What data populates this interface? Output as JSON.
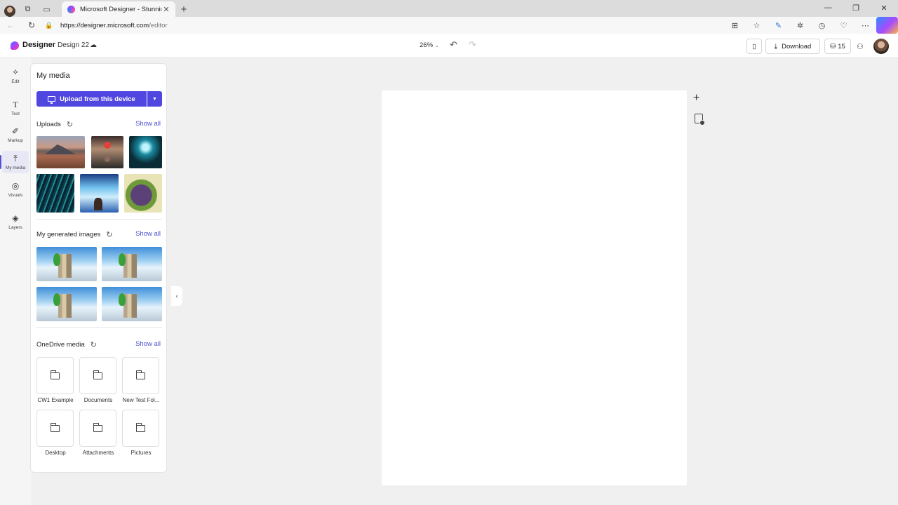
{
  "browser": {
    "tab_title": "Microsoft Designer - Stunning de",
    "url_host": "https://designer.microsoft.com",
    "url_path": "/editor"
  },
  "header": {
    "brand": "Designer",
    "design_name": "Design 22",
    "zoom": "26%",
    "download_label": "Download",
    "credits": "15"
  },
  "rail": [
    {
      "label": "Edit",
      "icon": "magic-edit-icon",
      "active": false
    },
    {
      "label": "Text",
      "icon": "text-icon",
      "active": false
    },
    {
      "label": "Markup",
      "icon": "pen-icon",
      "active": false
    },
    {
      "label": "My media",
      "icon": "upload-icon",
      "active": true
    },
    {
      "label": "Visuals",
      "icon": "shapes-icon",
      "active": false
    },
    {
      "label": "Layers",
      "icon": "layers-icon",
      "active": false
    }
  ],
  "panel": {
    "title": "My media",
    "upload_label": "Upload from this device",
    "uploads": {
      "title": "Uploads",
      "show_all": "Show all"
    },
    "generated": {
      "title": "My generated images",
      "show_all": "Show all"
    },
    "onedrive": {
      "title": "OneDrive media",
      "show_all": "Show all",
      "folders": [
        "CW1 Example",
        "Documents",
        "New Test Fol...",
        "Desktop",
        "Attachments",
        "Pictures"
      ]
    }
  },
  "colors": {
    "accent": "#4f47e0",
    "link": "#4a4fd0"
  }
}
